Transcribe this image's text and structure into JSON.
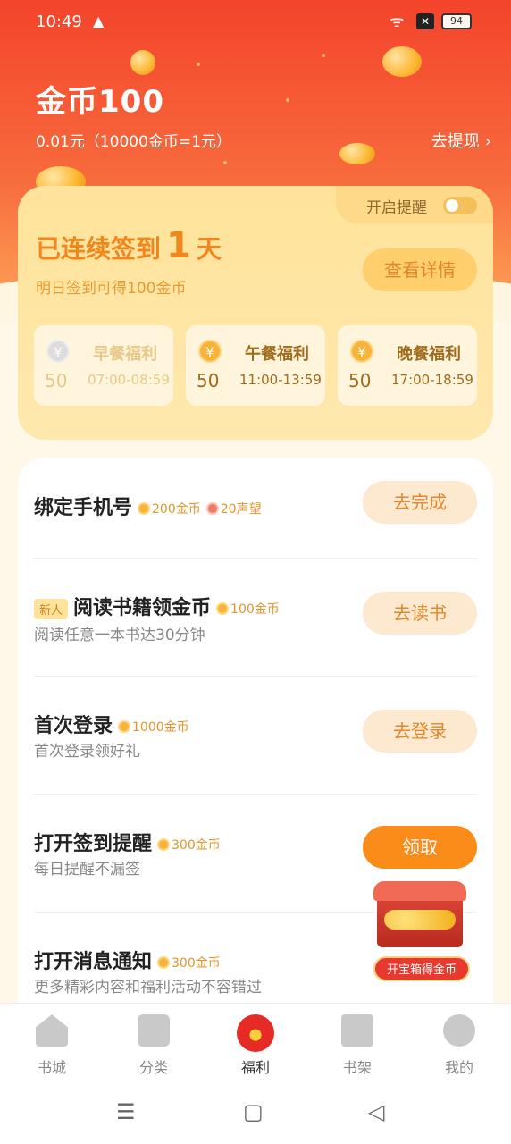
{
  "status_bar": {
    "time": "10:49",
    "warning_glyph": "▲",
    "wifi_glyph": "ᯤ",
    "x_glyph": "✕",
    "battery": "94"
  },
  "header": {
    "title": "金币100",
    "rate": "0.01元（10000金币=1元）",
    "withdraw_label": "去提现",
    "chevron": "›"
  },
  "sign": {
    "reminder_label": "开启提醒",
    "streak_prefix": "已连续签到",
    "streak_days": "1",
    "streak_suffix": "天",
    "tomorrow": "明日签到可得100金币",
    "detail_button": "查看详情",
    "meals": [
      {
        "name": "早餐福利",
        "value": "50",
        "time": "07:00-08:59",
        "coin_glyph": "¥"
      },
      {
        "name": "午餐福利",
        "value": "50",
        "time": "11:00-13:59",
        "coin_glyph": "¥"
      },
      {
        "name": "晚餐福利",
        "value": "50",
        "time": "17:00-18:59",
        "coin_glyph": "¥"
      }
    ]
  },
  "tasks": [
    {
      "title": "绑定手机号",
      "reward": "200金币",
      "reward2": "20声望",
      "subtitle": "",
      "button": "去完成"
    },
    {
      "badge": "新人",
      "title": "阅读书籍领金币",
      "reward": "100金币",
      "subtitle": "阅读任意一本书达30分钟",
      "button": "去读书"
    },
    {
      "title": "首次登录",
      "reward": "1000金币",
      "subtitle": "首次登录领好礼",
      "button": "去登录"
    },
    {
      "title": "打开签到提醒",
      "reward": "300金币",
      "subtitle": "每日提醒不漏签",
      "button": "领取"
    },
    {
      "title": "打开消息通知",
      "reward": "300金币",
      "subtitle": "更多精彩内容和福利活动不容错过",
      "button": ""
    }
  ],
  "treasure": {
    "label": "开宝箱得金币"
  },
  "bottom_nav": [
    {
      "label": "书城",
      "icon": "home-icon"
    },
    {
      "label": "分类",
      "icon": "category-icon"
    },
    {
      "label": "福利",
      "icon": "welfare-icon"
    },
    {
      "label": "书架",
      "icon": "bookshelf-icon"
    },
    {
      "label": "我的",
      "icon": "profile-icon"
    }
  ],
  "system_nav": {
    "menu": "☰",
    "home": "▢",
    "back": "◁"
  }
}
